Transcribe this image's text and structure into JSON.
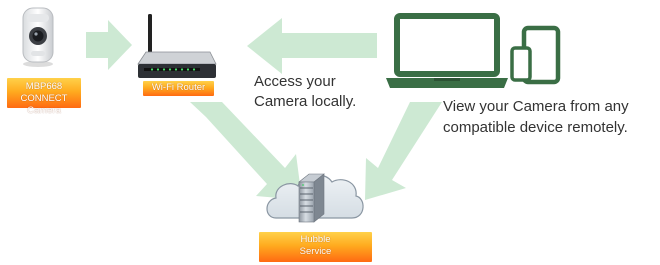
{
  "camera_label": {
    "line1": "MBP668 CONNECT",
    "line2": "Camera"
  },
  "router_label": "Wi-Fi Router",
  "local_access_caption": {
    "line1": "Access your",
    "line2": "Camera locally."
  },
  "remote_access_caption": {
    "line1": "View your Camera from any",
    "line2": "compatible device remotely."
  },
  "service_label": {
    "line1": "Hubble",
    "line2": "Service"
  },
  "colors": {
    "arrow": "#cde9d3",
    "device_green": "#3a6e45",
    "label_orange_top": "#ffd14a",
    "label_orange_bottom": "#ff6a12"
  }
}
